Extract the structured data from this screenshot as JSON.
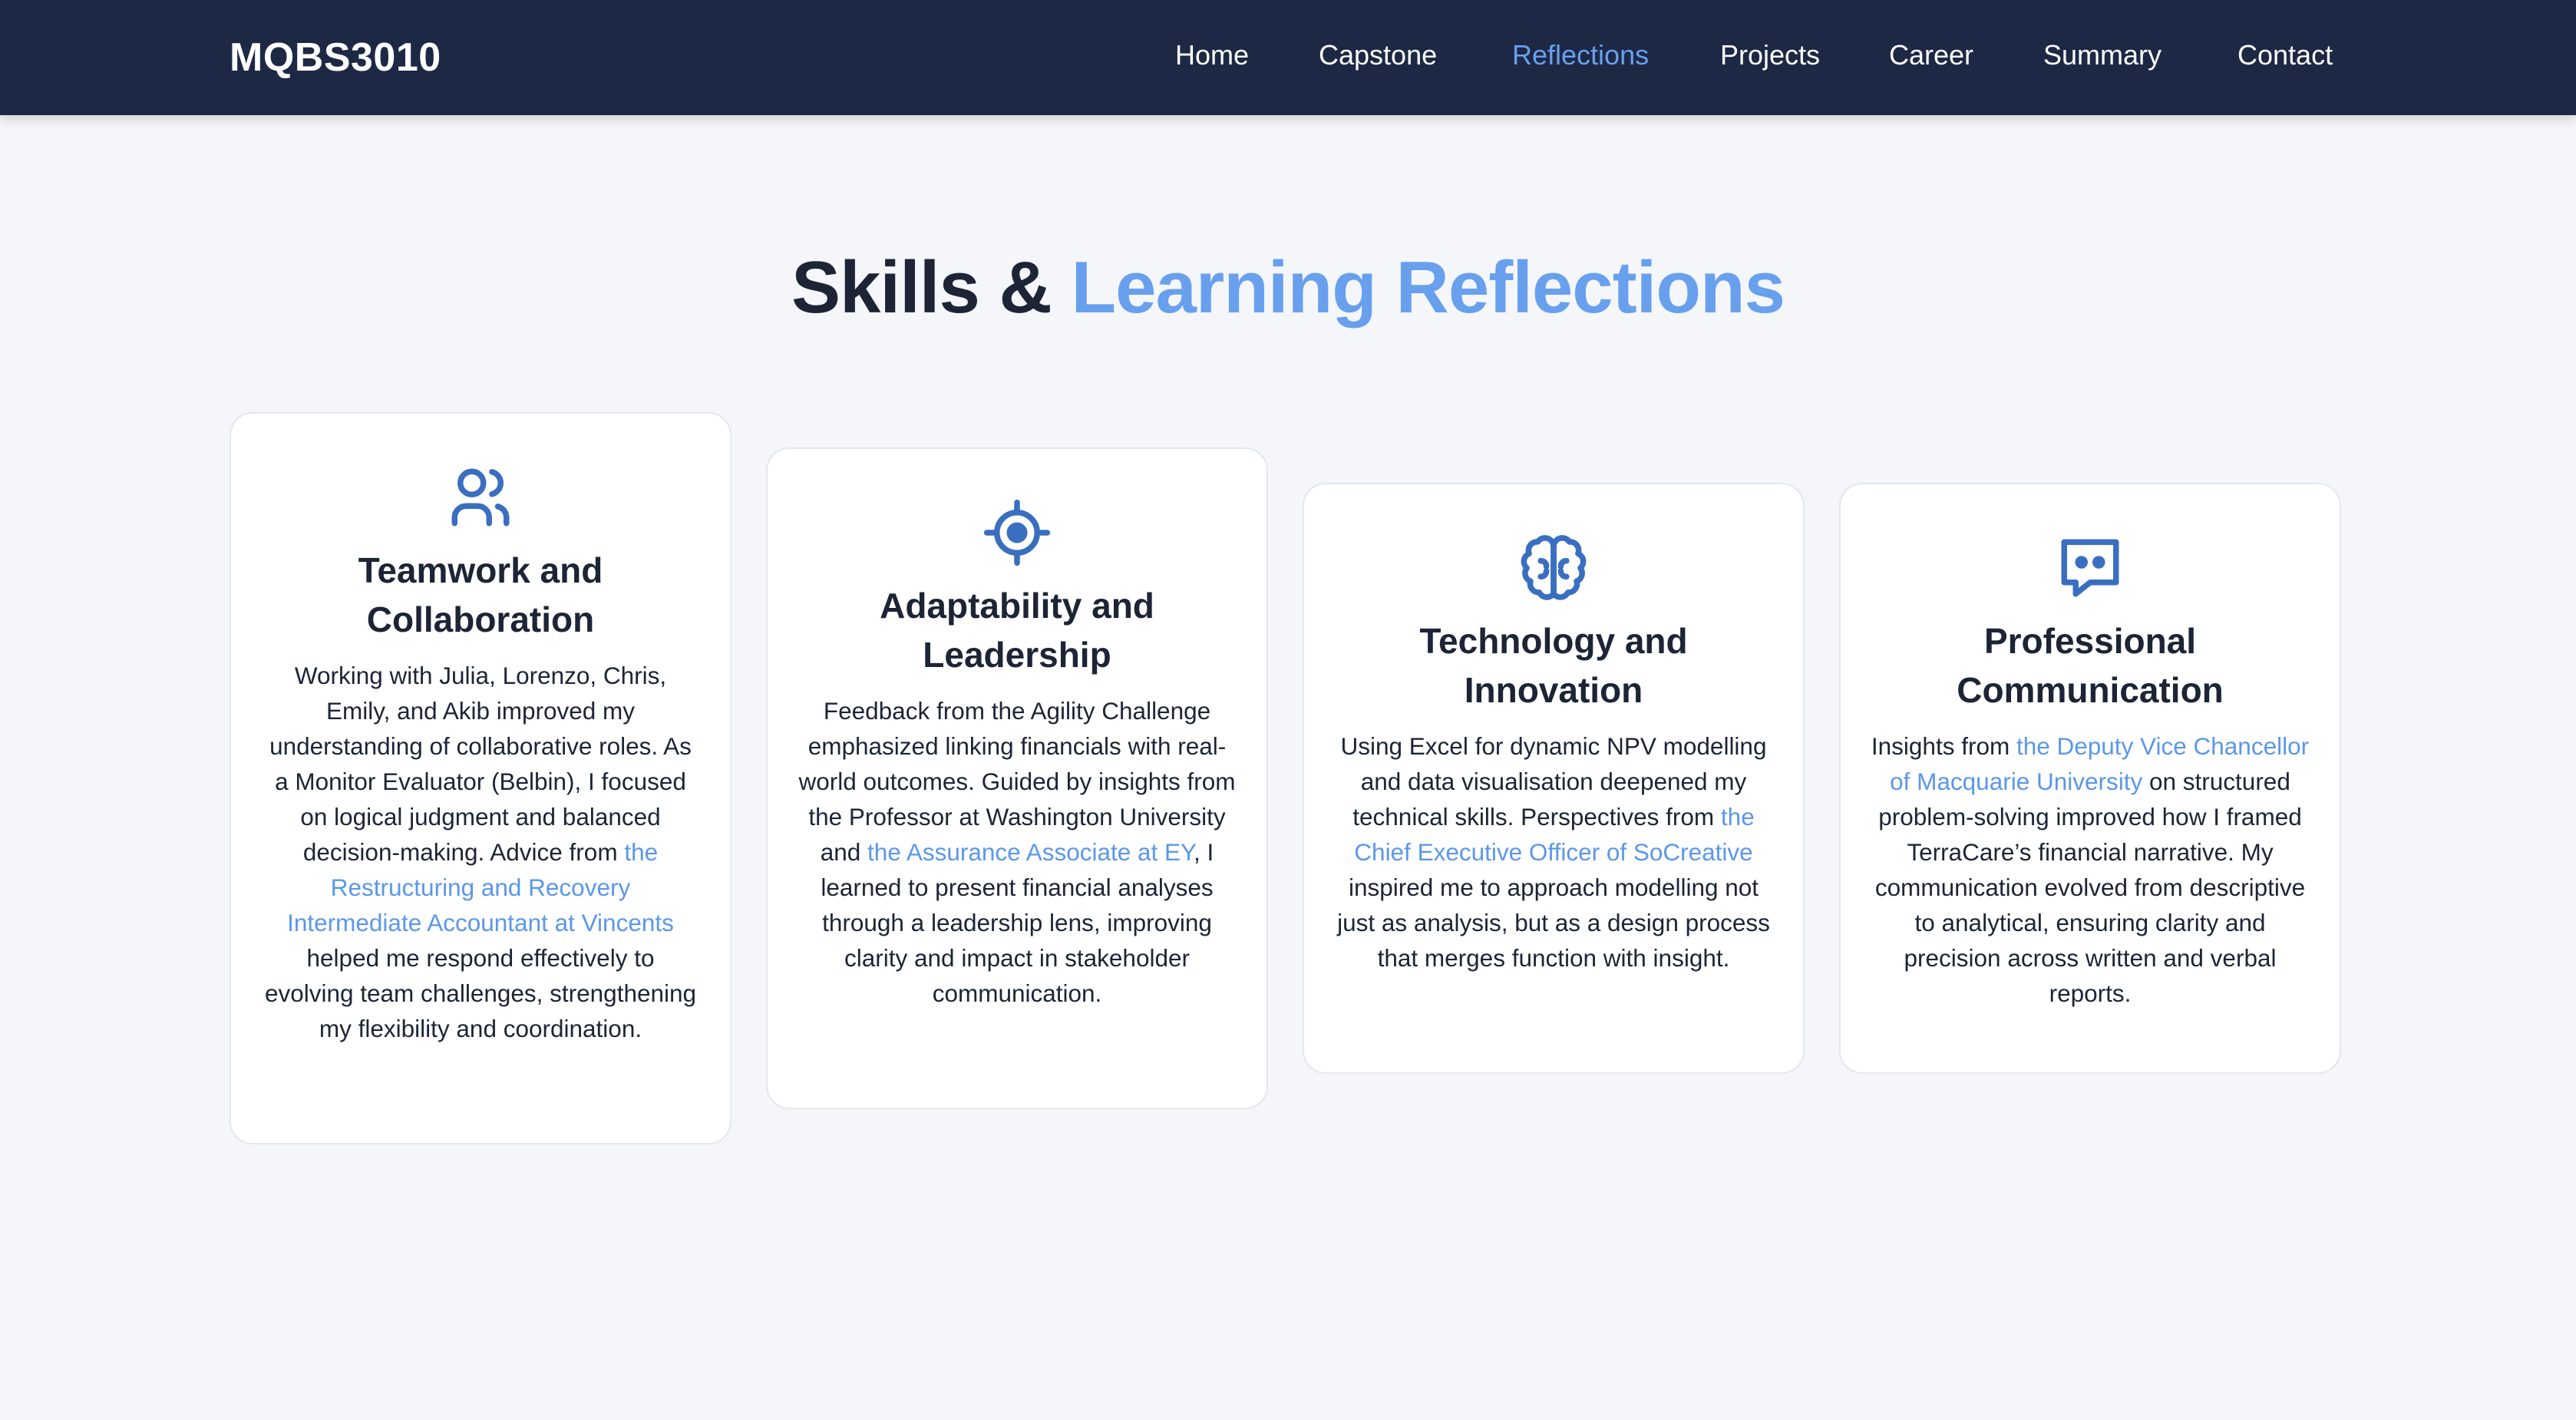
{
  "nav": {
    "brand": "MQBS3010",
    "links": [
      {
        "label": "Home",
        "active": false
      },
      {
        "label": "Capstone",
        "active": false
      },
      {
        "label": "Reflections",
        "active": true
      },
      {
        "label": "Projects",
        "active": false
      },
      {
        "label": "Career",
        "active": false
      },
      {
        "label": "Summary",
        "active": false
      },
      {
        "label": "Contact",
        "active": false
      }
    ]
  },
  "title": {
    "part1": "Skills & ",
    "part2": "Learning Reflections"
  },
  "colors": {
    "navbar": "#1d2845",
    "accent": "#68a0ee",
    "icon": "#3a6fc0",
    "background": "#f4f6fa"
  },
  "cards": [
    {
      "icon": "users-icon",
      "title": "Teamwork and Collaboration",
      "text_before": "Working with Julia, Lorenzo, Chris, Emily, and Akib improved my understanding of collaborative roles. As a Monitor Evaluator (Belbin), I focused on logical judgment and balanced decision-making. Advice from ",
      "link": "the Restructuring and Recovery Intermediate Accountant at Vincents",
      "text_after": " helped me respond effectively to evolving team challenges, strengthening my flexibility and coordination."
    },
    {
      "icon": "target-icon",
      "title": "Adaptability and Leadership",
      "text_before": "Feedback from the Agility Challenge emphasized linking financials with real-world outcomes. Guided by insights from the Professor at Washington University and ",
      "link": "the Assurance Associate at EY",
      "text_after": ", I learned to present financial analyses through a leadership lens, improving clarity and impact in stakeholder communication."
    },
    {
      "icon": "brain-icon",
      "title": "Technology and Innovation",
      "text_before": "Using Excel for dynamic NPV modelling and data visualisation deepened my technical skills. Perspectives from ",
      "link": "the Chief Executive Officer of SoCreative",
      "text_after": " inspired me to approach modelling not just as analysis, but as a design process that merges function with insight."
    },
    {
      "icon": "chat-icon",
      "title": "Professional Communication",
      "text_before": "Insights from ",
      "link": "the Deputy Vice Chancellor of Macquarie University",
      "text_after": " on structured problem-solving improved how I framed TerraCare’s financial narrative. My communication evolved from descriptive to analytical, ensuring clarity and precision across written and verbal reports."
    }
  ]
}
